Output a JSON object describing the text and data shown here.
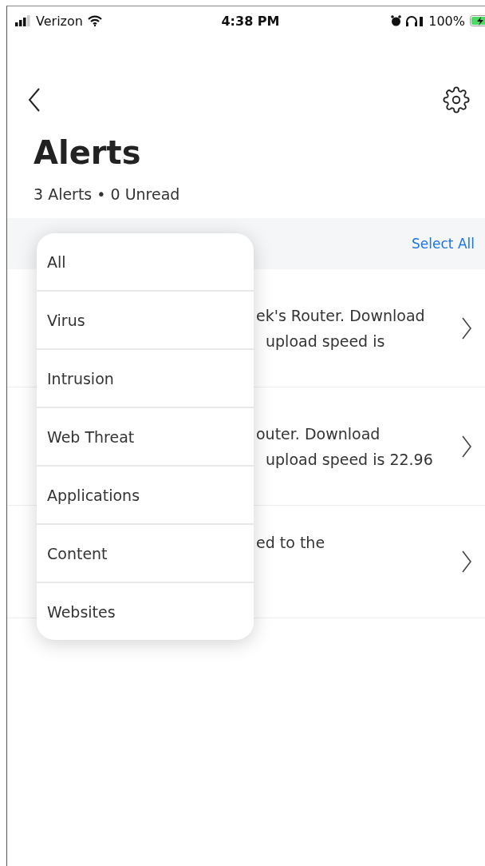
{
  "status_bar": {
    "carrier": "Verizon",
    "time": "4:38 PM",
    "battery": "100%"
  },
  "header": {
    "title": "Alerts",
    "subtitle": "3 Alerts • 0 Unread"
  },
  "filter_bar": {
    "select_all": "Select All"
  },
  "alerts": [
    {
      "lines": [
        "ek's Router. Download",
        "upload speed is"
      ]
    },
    {
      "lines": [
        "outer. Download",
        "upload speed is 22.96"
      ]
    },
    {
      "lines": [
        "ed to the"
      ]
    }
  ],
  "filter_menu": {
    "items": [
      "All",
      "Virus",
      "Intrusion",
      "Web Threat",
      "Applications",
      "Content",
      "Websites"
    ]
  }
}
